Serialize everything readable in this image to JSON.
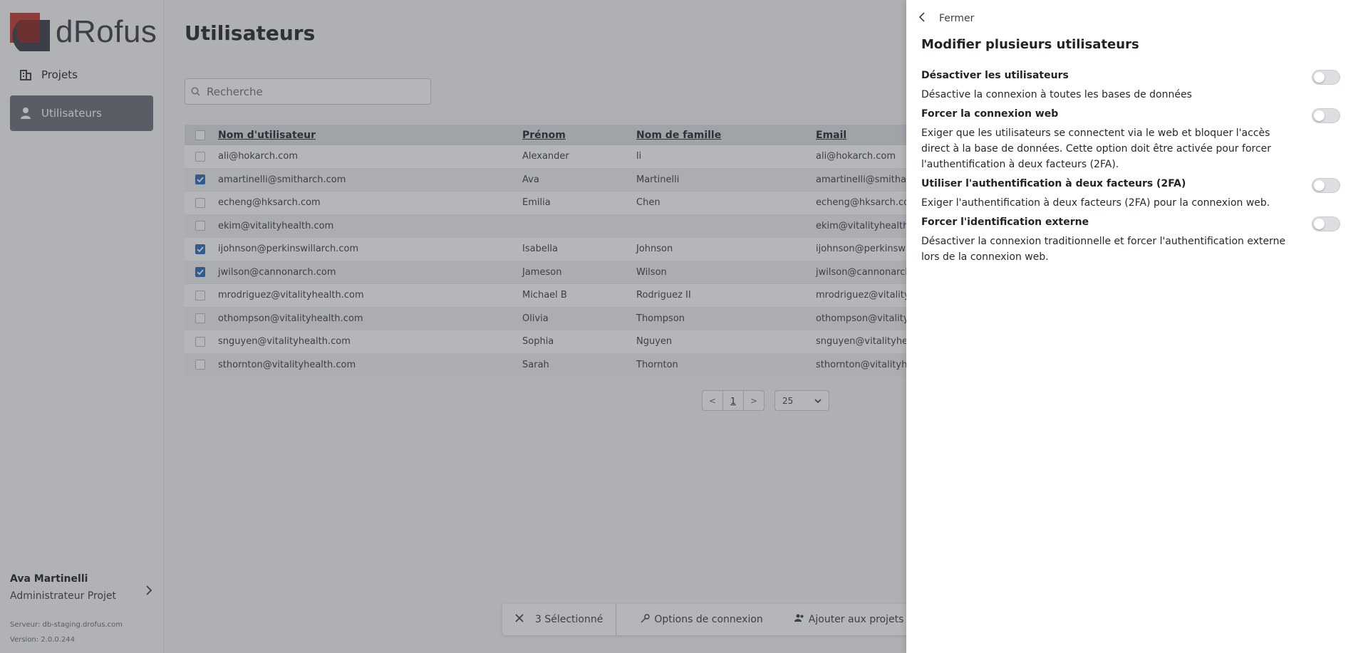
{
  "app": {
    "logo_text": "dRofus"
  },
  "sidebar": {
    "items": [
      {
        "label": "Projets",
        "icon": "building-icon"
      },
      {
        "label": "Utilisateurs",
        "icon": "user-icon"
      }
    ],
    "profile": {
      "name": "Ava Martinelli",
      "role": "Administrateur Projet"
    },
    "server": "Serveur: db-staging.drofus.com",
    "version": "Version: 2.0.0.244"
  },
  "main": {
    "title": "Utilisateurs",
    "search": {
      "placeholder": "Recherche"
    },
    "table": {
      "headers": [
        "Nom d'utilisateur",
        "Prénom",
        "Nom de famille",
        "Email"
      ],
      "rows": [
        {
          "username": "ali@hokarch.com",
          "first": "Alexander",
          "last": "li",
          "email": "ali@hokarch.com",
          "checked": false
        },
        {
          "username": "amartinelli@smitharch.com",
          "first": "Ava",
          "last": "Martinelli",
          "email": "amartinelli@smitharch",
          "checked": true
        },
        {
          "username": "echeng@hksarch.com",
          "first": "Emilia",
          "last": "Chen",
          "email": "echeng@hksarch.com",
          "checked": false
        },
        {
          "username": "ekim@vitalityhealth.com",
          "first": "",
          "last": "",
          "email": "ekim@vitalityhealth.c",
          "checked": false
        },
        {
          "username": "ijohnson@perkinswillarch.com",
          "first": "Isabella",
          "last": "Johnson",
          "email": "ijohnson@perkinswilla",
          "checked": true
        },
        {
          "username": "jwilson@cannonarch.com",
          "first": "Jameson",
          "last": "Wilson",
          "email": "jwilson@cannonarch.c",
          "checked": true
        },
        {
          "username": "mrodriguez@vitalityhealth.com",
          "first": "Michael B",
          "last": "Rodriguez II",
          "email": "mrodriguez@vitalityhe",
          "checked": false
        },
        {
          "username": "othompson@vitalityhealth.com",
          "first": "Olivia",
          "last": "Thompson",
          "email": "othompson@vitalityhe",
          "checked": false
        },
        {
          "username": "snguyen@vitalityhealth.com",
          "first": "Sophia",
          "last": "Nguyen",
          "email": "snguyen@vitalityhealt",
          "checked": false
        },
        {
          "username": "sthornton@vitalityhealth.com",
          "first": "Sarah",
          "last": "Thornton",
          "email": "sthornton@vitalityhea",
          "checked": false
        }
      ]
    },
    "pagination": {
      "prev": "<",
      "page": "1",
      "next": ">",
      "per_page": "25"
    },
    "actionbar": {
      "selected": "3 Sélectionné",
      "login_options": "Options de connexion",
      "add_to_projects": "Ajouter aux projets"
    }
  },
  "drawer": {
    "close_label": "Fermer",
    "title": "Modifier plusieurs utilisateurs",
    "options": [
      {
        "title": "Désactiver les utilisateurs",
        "desc": "Désactive la connexion à toutes les bases de données",
        "enabled": false
      },
      {
        "title": "Forcer la connexion web",
        "desc": "Exiger que les utilisateurs se connectent via le web et bloquer l'accès direct à la base de données. Cette option doit être activée pour forcer l'authentification à deux facteurs (2FA).",
        "enabled": false
      },
      {
        "title": "Utiliser l'authentification à deux facteurs (2FA)",
        "desc": "Exiger l'authentification à deux facteurs (2FA) pour la connexion web.",
        "enabled": false
      },
      {
        "title": "Forcer l'identification externe",
        "desc": "Désactiver la connexion traditionnelle et forcer l'authentification externe lors de la connexion web.",
        "enabled": false
      }
    ]
  },
  "colors": {
    "brand_red": "#c43b32",
    "checkbox_blue": "#2c6fbd",
    "nav_active": "#6b7079"
  }
}
